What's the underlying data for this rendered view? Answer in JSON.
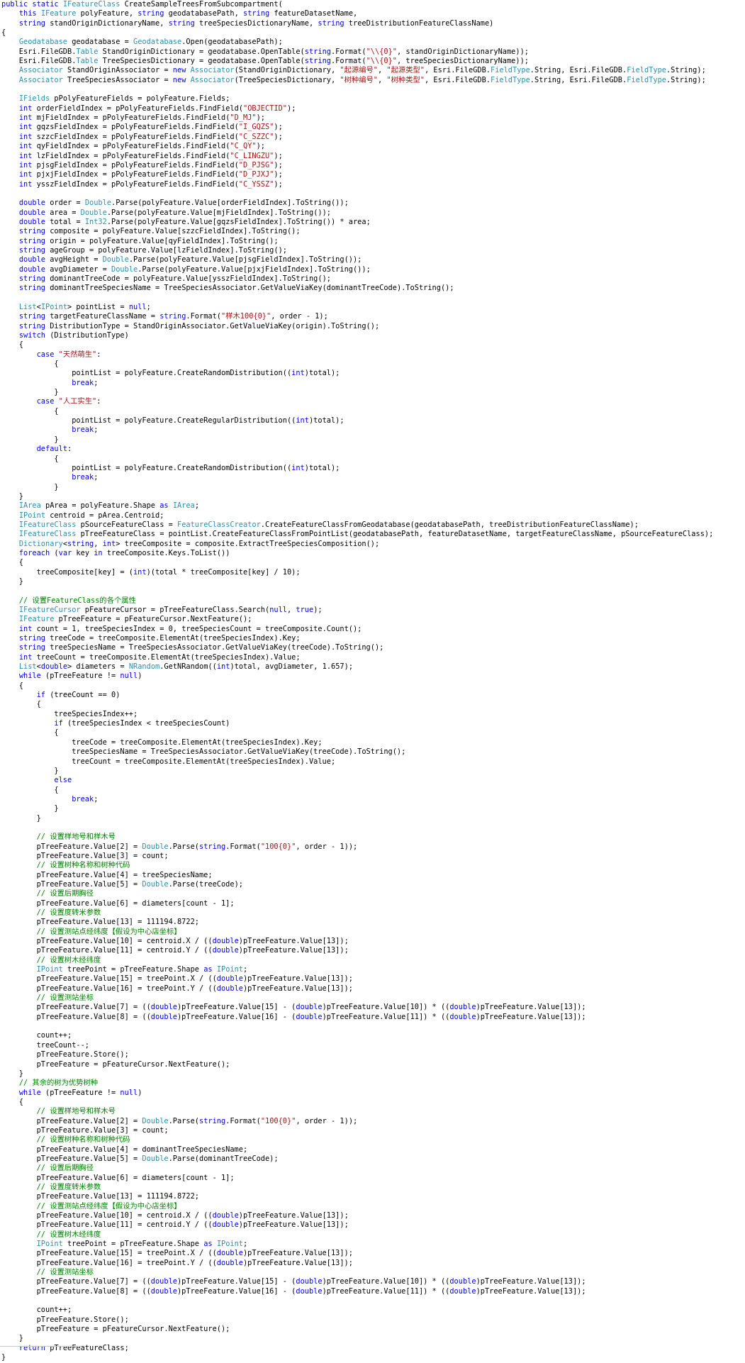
{
  "code_lines": [
    "public static IFeatureClass CreateSampleTreesFromSubcompartment(",
    "    this IFeature polyFeature, string geodatabasePath, string featureDatasetName,",
    "    string standOriginDictionaryName, string treeSpeciesDictionaryName, string treeDistributionFeatureClassName)",
    "{",
    "    Geodatabase geodatabase = Geodatabase.Open(geodatabasePath);",
    "    Esri.FileGDB.Table StandOriginDictionary = geodatabase.OpenTable(string.Format(\"\\\\{0}\", standOriginDictionaryName));",
    "    Esri.FileGDB.Table TreeSpeciesDictionary = geodatabase.OpenTable(string.Format(\"\\\\{0}\", treeSpeciesDictionaryName));",
    "    Associator StandOriginAssociator = new Associator(StandOriginDictionary, \"起源编号\", \"起源类型\", Esri.FileGDB.FieldType.String, Esri.FileGDB.FieldType.String);",
    "    Associator TreeSpeciesAssociator = new Associator(TreeSpeciesDictionary, \"树种编号\", \"树种类型\", Esri.FileGDB.FieldType.String, Esri.FileGDB.FieldType.String);",
    "",
    "    IFields pPolyFeatureFields = polyFeature.Fields;",
    "    int orderFieldIndex = pPolyFeatureFields.FindField(\"OBJECTID\");",
    "    int mjFieldIndex = pPolyFeatureFields.FindField(\"D_MJ\");",
    "    int gqzsFieldIndex = pPolyFeatureFields.FindField(\"I_GQZS\");",
    "    int szzcFieldIndex = pPolyFeatureFields.FindField(\"C_SZZC\");",
    "    int qyFieldIndex = pPolyFeatureFields.FindField(\"C_QY\");",
    "    int lzFieldIndex = pPolyFeatureFields.FindField(\"C_LINGZU\");",
    "    int pjsgFieldIndex = pPolyFeatureFields.FindField(\"D_PJSG\");",
    "    int pjxjFieldIndex = pPolyFeatureFields.FindField(\"D_PJXJ\");",
    "    int ysszFieldIndex = pPolyFeatureFields.FindField(\"C_YSSZ\");",
    "",
    "    double order = Double.Parse(polyFeature.Value[orderFieldIndex].ToString());",
    "    double area = Double.Parse(polyFeature.Value[mjFieldIndex].ToString());",
    "    double total = Int32.Parse(polyFeature.Value[gqzsFieldIndex].ToString()) * area;",
    "    string composite = polyFeature.Value[szzcFieldIndex].ToString();",
    "    string origin = polyFeature.Value[qyFieldIndex].ToString();",
    "    string ageGroup = polyFeature.Value[lzFieldIndex].ToString();",
    "    double avgHeight = Double.Parse(polyFeature.Value[pjsgFieldIndex].ToString());",
    "    double avgDiameter = Double.Parse(polyFeature.Value[pjxjFieldIndex].ToString());",
    "    string dominantTreeCode = polyFeature.Value[ysszFieldIndex].ToString();",
    "    string dominantTreeSpeciesName = TreeSpeciesAssociator.GetValueViaKey(dominantTreeCode).ToString();",
    "",
    "    List<IPoint> pointList = null;",
    "    string targetFeatureClassName = string.Format(\"样木100{0}\", order - 1);",
    "    string DistributionType = StandOriginAssociator.GetValueViaKey(origin).ToString();",
    "    switch (DistributionType)",
    "    {",
    "        case \"天然萌生\":",
    "            {",
    "                pointList = polyFeature.CreateRandomDistribution((int)total);",
    "                break;",
    "            }",
    "        case \"人工实生\":",
    "            {",
    "                pointList = polyFeature.CreateRegularDistribution((int)total);",
    "                break;",
    "            }",
    "        default:",
    "            {",
    "                pointList = polyFeature.CreateRandomDistribution((int)total);",
    "                break;",
    "            }",
    "    }",
    "    IArea pArea = polyFeature.Shape as IArea;",
    "    IPoint centroid = pArea.Centroid;",
    "    IFeatureClass pSourceFeatureClass = FeatureClassCreator.CreateFeatureClassFromGeodatabase(geodatabasePath, treeDistributionFeatureClassName);",
    "    IFeatureClass pTreeFeatureClass = pointList.CreateFeatureClassFromPointList(geodatabasePath, featureDatasetName, targetFeatureClassName, pSourceFeatureClass);",
    "    Dictionary<string, int> treeComposite = composite.ExtractTreeSpeciesComposition();",
    "    foreach (var key in treeComposite.Keys.ToList())",
    "    {",
    "        treeComposite[key] = (int)(total * treeComposite[key] / 10);",
    "    }",
    "",
    "    // 设置FeatureClass的各个属性",
    "    IFeatureCursor pFeatureCursor = pTreeFeatureClass.Search(null, true);",
    "    IFeature pTreeFeature = pFeatureCursor.NextFeature();",
    "    int count = 1, treeSpeciesIndex = 0, treeSpeciesCount = treeComposite.Count();",
    "    string treeCode = treeComposite.ElementAt(treeSpeciesIndex).Key;",
    "    string treeSpeciesName = TreeSpeciesAssociator.GetValueViaKey(treeCode).ToString();",
    "    int treeCount = treeComposite.ElementAt(treeSpeciesIndex).Value;",
    "    List<double> diameters = NRandom.GetNRandom((int)total, avgDiameter, 1.657);",
    "    while (pTreeFeature != null)",
    "    {",
    "        if (treeCount == 0)",
    "        {",
    "            treeSpeciesIndex++;",
    "            if (treeSpeciesIndex < treeSpeciesCount)",
    "            {",
    "                treeCode = treeComposite.ElementAt(treeSpeciesIndex).Key;",
    "                treeSpeciesName = TreeSpeciesAssociator.GetValueViaKey(treeCode).ToString();",
    "                treeCount = treeComposite.ElementAt(treeSpeciesIndex).Value;",
    "            }",
    "            else",
    "            {",
    "                break;",
    "            }",
    "        }",
    "",
    "        // 设置样地号和样木号",
    "        pTreeFeature.Value[2] = Double.Parse(string.Format(\"100{0}\", order - 1));",
    "        pTreeFeature.Value[3] = count;",
    "        // 设置树种名称和树种代码",
    "        pTreeFeature.Value[4] = treeSpeciesName;",
    "        pTreeFeature.Value[5] = Double.Parse(treeCode);",
    "        // 设置后期胸径",
    "        pTreeFeature.Value[6] = diameters[count - 1];",
    "        // 设置度转米参数",
    "        pTreeFeature.Value[13] = 111194.8722;",
    "        // 设置测站点经纬度【假设为中心店坐标】",
    "        pTreeFeature.Value[10] = centroid.X / ((double)pTreeFeature.Value[13]);",
    "        pTreeFeature.Value[11] = centroid.Y / ((double)pTreeFeature.Value[13]);",
    "        // 设置树木经纬度",
    "        IPoint treePoint = pTreeFeature.Shape as IPoint;",
    "        pTreeFeature.Value[15] = treePoint.X / ((double)pTreeFeature.Value[13]);",
    "        pTreeFeature.Value[16] = treePoint.Y / ((double)pTreeFeature.Value[13]);",
    "        // 设置测站坐标",
    "        pTreeFeature.Value[7] = ((double)pTreeFeature.Value[15] - (double)pTreeFeature.Value[10]) * ((double)pTreeFeature.Value[13]);",
    "        pTreeFeature.Value[8] = ((double)pTreeFeature.Value[16] - (double)pTreeFeature.Value[11]) * ((double)pTreeFeature.Value[13]);",
    "",
    "        count++;",
    "        treeCount--;",
    "        pTreeFeature.Store();",
    "        pTreeFeature = pFeatureCursor.NextFeature();",
    "    }",
    "    // 其余的树为优势树种",
    "    while (pTreeFeature != null)",
    "    {",
    "        // 设置样地号和样木号",
    "        pTreeFeature.Value[2] = Double.Parse(string.Format(\"100{0}\", order - 1));",
    "        pTreeFeature.Value[3] = count;",
    "        // 设置树种名称和树种代码",
    "        pTreeFeature.Value[4] = dominantTreeSpeciesName;",
    "        pTreeFeature.Value[5] = Double.Parse(dominantTreeCode);",
    "        // 设置后期胸径",
    "        pTreeFeature.Value[6] = diameters[count - 1];",
    "        // 设置度转米参数",
    "        pTreeFeature.Value[13] = 111194.8722;",
    "        // 设置测站点经纬度【假设为中心店坐标】",
    "        pTreeFeature.Value[10] = centroid.X / ((double)pTreeFeature.Value[13]);",
    "        pTreeFeature.Value[11] = centroid.Y / ((double)pTreeFeature.Value[13]);",
    "        // 设置树木经纬度",
    "        IPoint treePoint = pTreeFeature.Shape as IPoint;",
    "        pTreeFeature.Value[15] = treePoint.X / ((double)pTreeFeature.Value[13]);",
    "        pTreeFeature.Value[16] = treePoint.Y / ((double)pTreeFeature.Value[13]);",
    "        // 设置测站坐标",
    "        pTreeFeature.Value[7] = ((double)pTreeFeature.Value[15] - (double)pTreeFeature.Value[10]) * ((double)pTreeFeature.Value[13]);",
    "        pTreeFeature.Value[8] = ((double)pTreeFeature.Value[16] - (double)pTreeFeature.Value[11]) * ((double)pTreeFeature.Value[13]);",
    "",
    "        count++;",
    "        pTreeFeature.Store();",
    "        pTreeFeature = pFeatureCursor.NextFeature();",
    "    }",
    "    return pTreeFeatureClass;",
    "}"
  ],
  "syntax_colors": {
    "keyword": "#0000ff",
    "type": "#2b91af",
    "string": "#a31515",
    "comment": "#008000",
    "text": "#000000"
  }
}
